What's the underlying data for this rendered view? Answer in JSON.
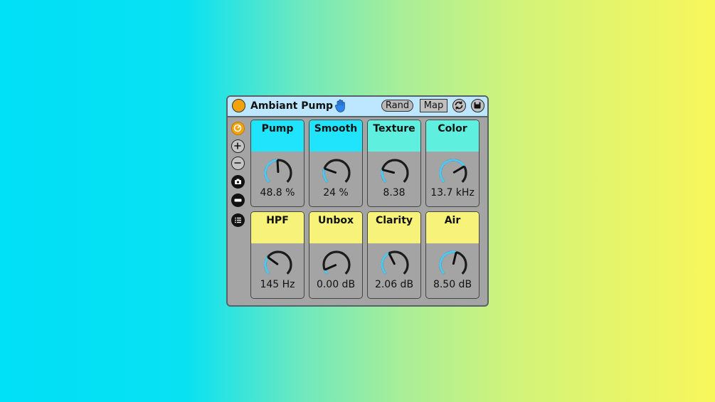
{
  "device": {
    "title": "Ambiant Pump",
    "rand_label": "Rand",
    "map_label": "Map",
    "icons": [
      "hand-icon",
      "refresh-icon",
      "save-icon"
    ]
  },
  "sidebar": {
    "items": [
      {
        "name": "macro-icon"
      },
      {
        "name": "add-variation-icon"
      },
      {
        "name": "remove-variation-icon"
      },
      {
        "name": "camera-icon"
      },
      {
        "name": "minus-icon"
      },
      {
        "name": "list-icon"
      }
    ]
  },
  "colors": {
    "cyan": "#1fe4fb",
    "mint": "#5fefdf",
    "yellow": "#f6f27a",
    "knob_arc": "#4ec8f0",
    "power": "#f1a20e"
  },
  "macros": [
    {
      "label": "Pump",
      "value": "48.8 %",
      "position": 0.488,
      "color": "#1fe4fb"
    },
    {
      "label": "Smooth",
      "value": "24 %",
      "position": 0.24,
      "color": "#1fe4fb"
    },
    {
      "label": "Texture",
      "value": "8.38",
      "position": 0.22,
      "color": "#5fefdf"
    },
    {
      "label": "Color",
      "value": "13.7 kHz",
      "position": 0.72,
      "color": "#5fefdf"
    },
    {
      "label": "HPF",
      "value": "145 Hz",
      "position": 0.3,
      "color": "#f6f27a"
    },
    {
      "label": "Unbox",
      "value": "0.00 dB",
      "position": 0.08,
      "color": "#f6f27a"
    },
    {
      "label": "Clarity",
      "value": "2.06 dB",
      "position": 0.4,
      "color": "#f6f27a"
    },
    {
      "label": "Air",
      "value": "8.50 dB",
      "position": 0.55,
      "color": "#f6f27a"
    }
  ]
}
